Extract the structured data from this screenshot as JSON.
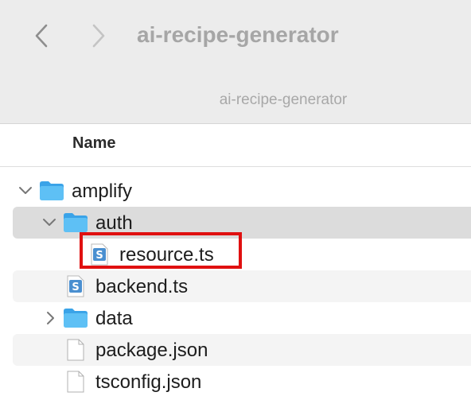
{
  "toolbar": {
    "title": "ai-recipe-generator",
    "path_title": "ai-recipe-generator",
    "back_icon": "chevron-left-icon",
    "forward_icon": "chevron-right-icon"
  },
  "list_header": {
    "name_column": "Name"
  },
  "files": [
    {
      "name": "amplify",
      "kind": "folder",
      "expanded": true,
      "depth": 0,
      "icon": "folder-icon"
    },
    {
      "name": "auth",
      "kind": "folder",
      "expanded": true,
      "depth": 1,
      "selected": true,
      "icon": "folder-icon"
    },
    {
      "name": "resource.ts",
      "kind": "file",
      "depth": 2,
      "highlighted": true,
      "icon": "typescript-file-icon"
    },
    {
      "name": "backend.ts",
      "kind": "file",
      "depth": 1,
      "icon": "typescript-file-icon"
    },
    {
      "name": "data",
      "kind": "folder",
      "expanded": false,
      "depth": 1,
      "icon": "folder-icon"
    },
    {
      "name": "package.json",
      "kind": "file",
      "depth": 1,
      "icon": "document-icon"
    },
    {
      "name": "tsconfig.json",
      "kind": "file",
      "depth": 1,
      "icon": "document-icon"
    }
  ],
  "colors": {
    "toolbar_bg": "#ececec",
    "selected_row": "#dcdcdc",
    "alt_row": "#f4f4f4",
    "folder_blue": "#4ab3f0",
    "highlight_red": "#e01010"
  }
}
